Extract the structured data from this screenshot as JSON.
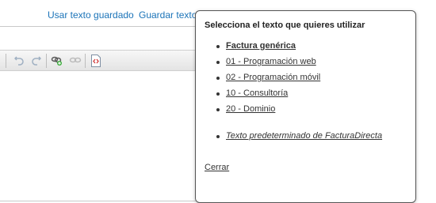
{
  "header": {
    "use_saved_text_label": "Usar texto guardado",
    "save_text_label": "Guardar texto"
  },
  "toolbar": {
    "buttons": [
      "undo-icon",
      "redo-icon",
      "insert-link-icon",
      "unlink-icon",
      "source-code-icon"
    ]
  },
  "popup": {
    "title": "Selecciona el texto que quieres utilizar",
    "items": [
      {
        "label": "Factura genérica"
      },
      {
        "label": "01 - Programación web"
      },
      {
        "label": "02 - Programación móvil"
      },
      {
        "label": "10 - Consultoría"
      },
      {
        "label": "20 - Dominio"
      },
      {
        "label": "Texto predeterminado de FacturaDirecta"
      }
    ],
    "close_label": "Cerrar"
  },
  "colors": {
    "link_blue": "#1a73b8",
    "popup_border": "#555555",
    "text": "#333333"
  }
}
